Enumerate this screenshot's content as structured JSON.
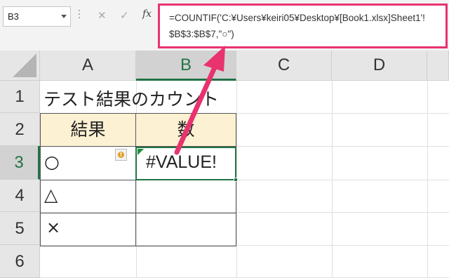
{
  "name_box": {
    "value": "B3"
  },
  "formula_bar": {
    "cancel_glyph": "✕",
    "enter_glyph": "✓",
    "fx_label": "fx",
    "formula_line1": "=COUNTIF('C:¥Users¥keiri05¥Desktop¥[Book1.xlsx]Sheet1'!",
    "formula_line2": "$B$3:$B$7,\"○\")"
  },
  "columns": [
    "A",
    "B",
    "C",
    "D"
  ],
  "rows": [
    "1",
    "2",
    "3",
    "4",
    "5",
    "6"
  ],
  "cells": {
    "A1": "テスト結果のカウント",
    "A2": "結果",
    "B2": "数",
    "A3": "○",
    "B3": "#VALUE!",
    "A4": "△",
    "A5": "×"
  },
  "colors": {
    "accent_green": "#217346",
    "highlight_pink": "#e8336f",
    "header_fill": "#fdf1d3"
  },
  "icons": {
    "error_indicator": "warning-icon",
    "arrow": "pink-arrow-annotation"
  }
}
